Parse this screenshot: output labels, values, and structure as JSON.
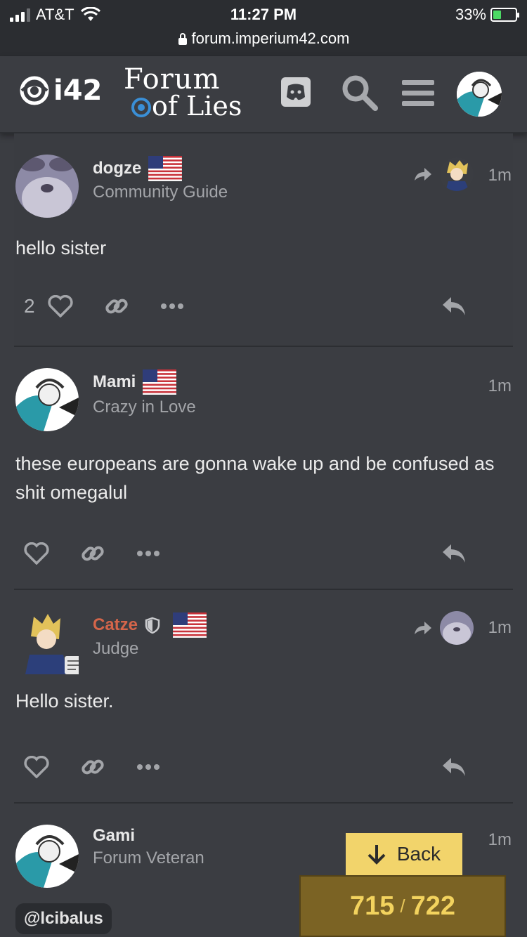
{
  "status_bar": {
    "carrier": "AT&T",
    "time": "11:27 PM",
    "url": "forum.imperium42.com",
    "battery": "33%"
  },
  "header": {
    "logo_text": "i42",
    "title_line1": "Forum",
    "title_line2": "of Lies",
    "icons": [
      "discord-icon",
      "search-icon",
      "menu-icon",
      "user-avatar"
    ]
  },
  "posts": [
    {
      "username": "dogze",
      "user_title": "Community Guide",
      "time": "1m",
      "text": "hello sister",
      "like_count": "2",
      "flag": "us"
    },
    {
      "username": "Mami",
      "user_title": "Crazy in Love",
      "time": "1m",
      "text": "these europeans are gonna wake up and be confused as shit omegalul",
      "flag": "us"
    },
    {
      "username": "Catze",
      "user_title": "Judge",
      "time": "1m",
      "text": "Hello sister.",
      "flag": "us",
      "name_color": "#d4654a"
    },
    {
      "username": "Gami",
      "user_title": "Forum Veteran",
      "time": "1m"
    }
  ],
  "mention": "@lcibalus",
  "back_button": "Back",
  "progress": {
    "current": "715",
    "sep": "/",
    "total": "722"
  },
  "colors": {
    "background": "#3b3d42",
    "accent_yellow": "#f2d46b",
    "counter_bg": "#7b6324"
  }
}
